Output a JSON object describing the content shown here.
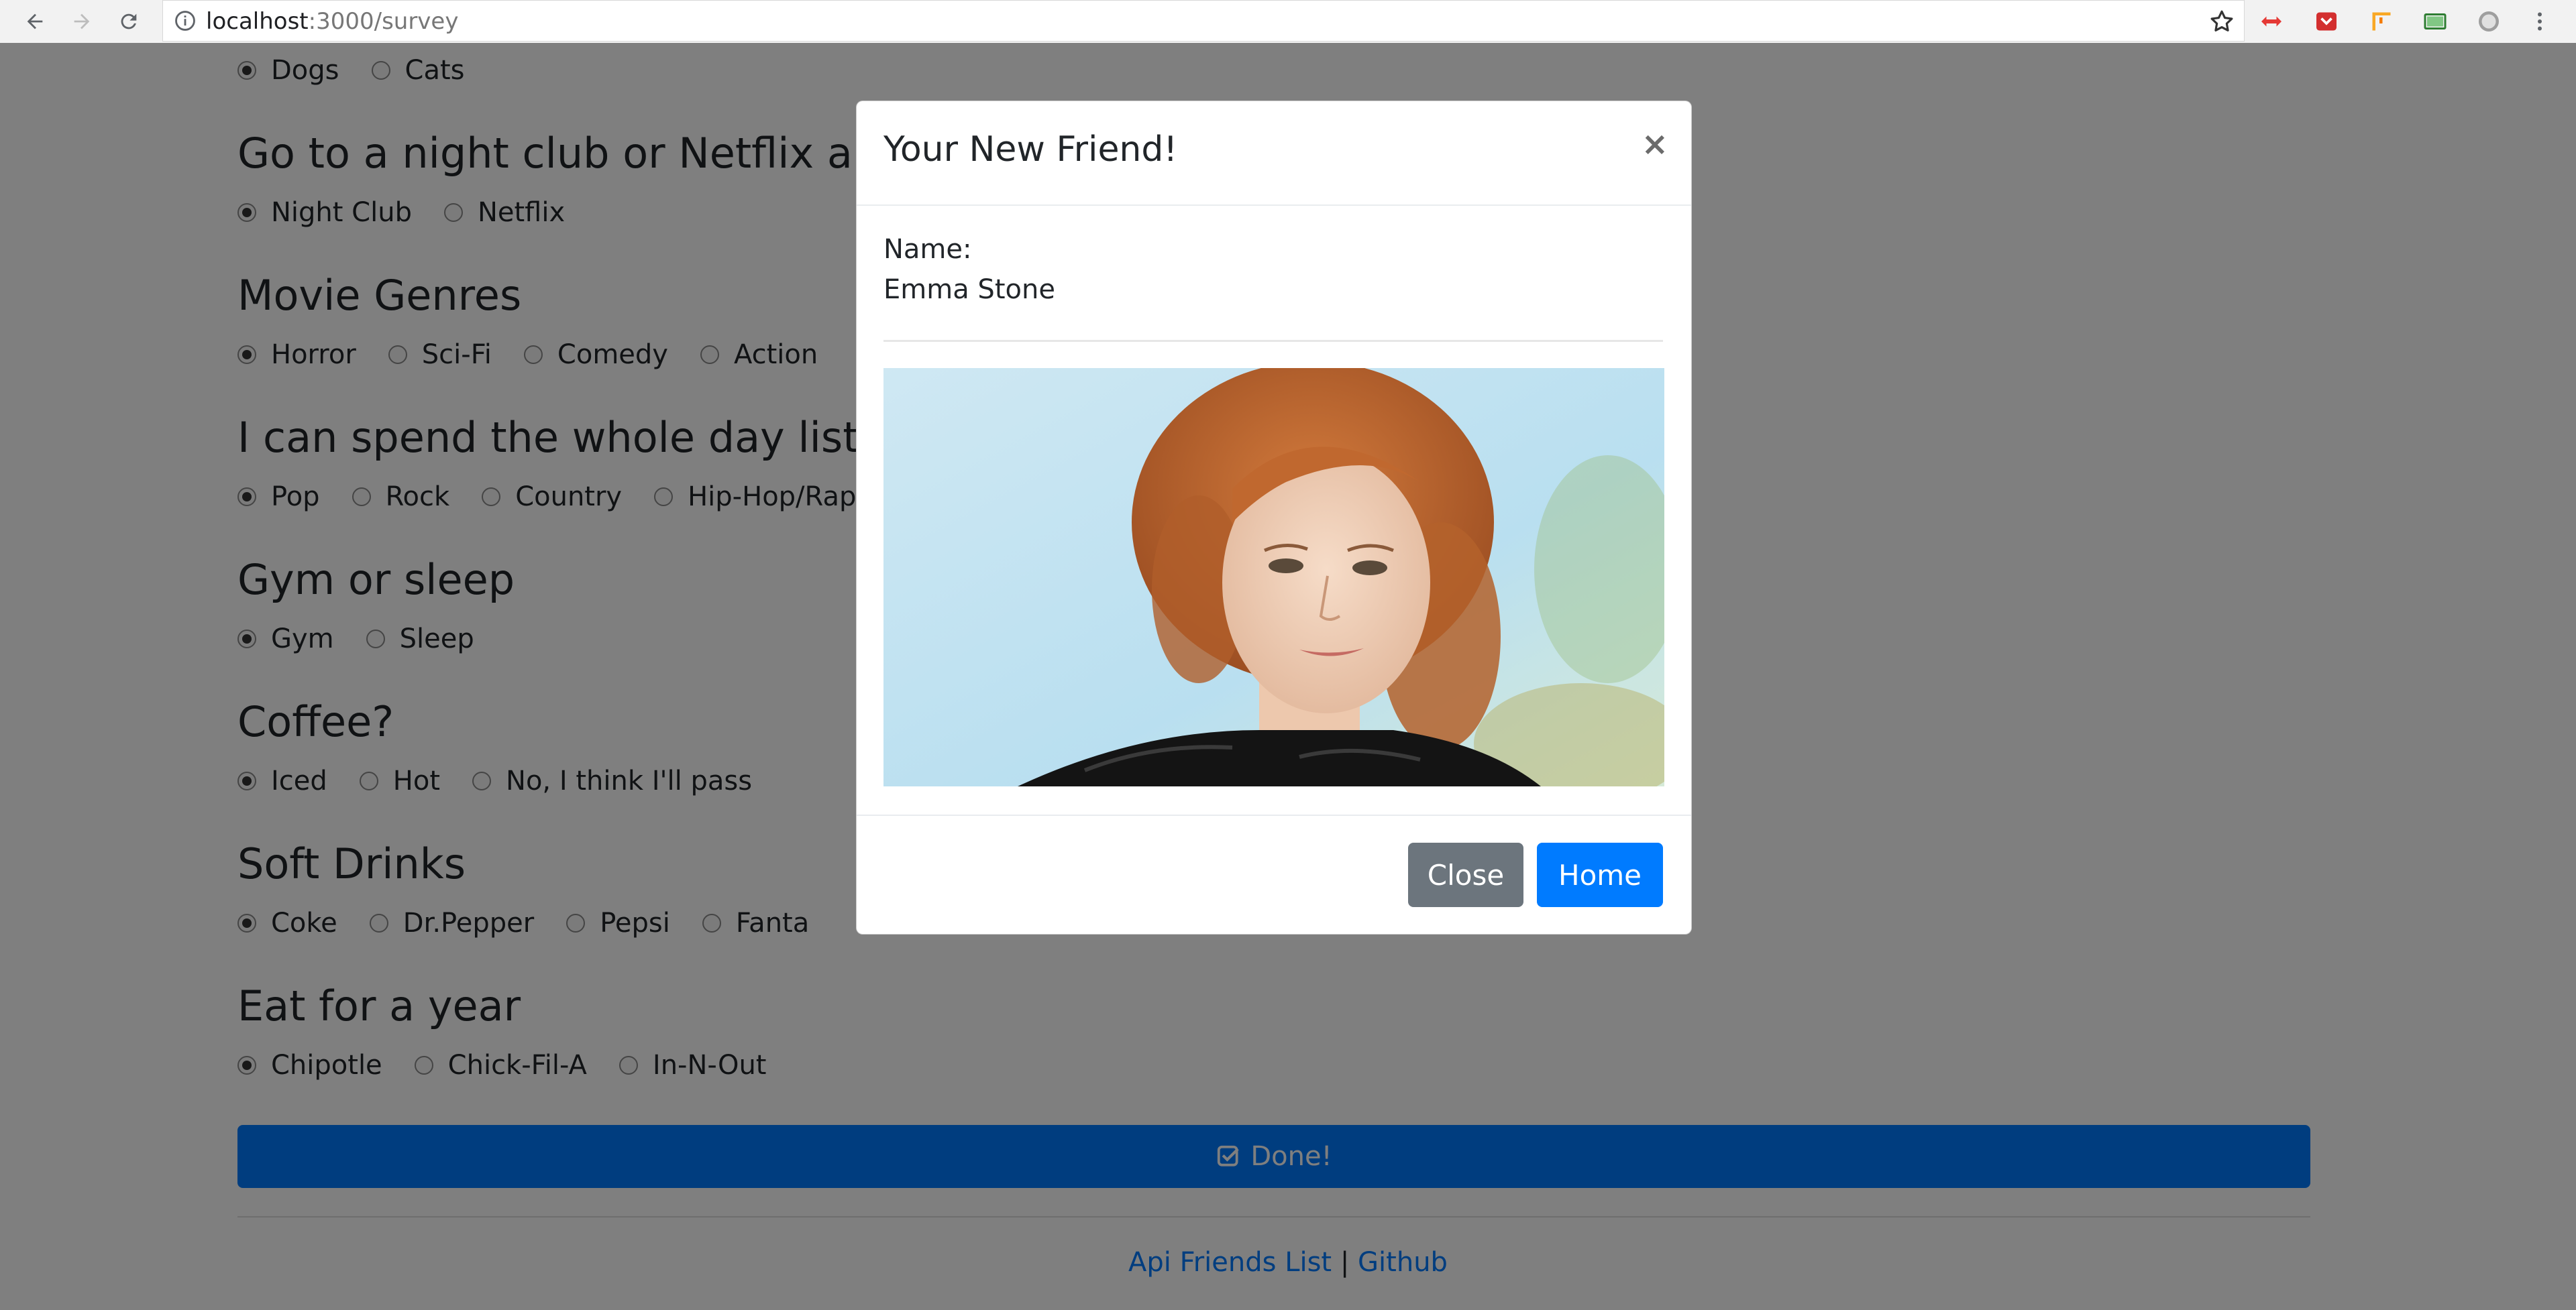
{
  "browser": {
    "url_host": "localhost",
    "url_path": ":3000/survey",
    "icons": [
      "back-icon",
      "forward-icon",
      "reload-icon",
      "info-icon",
      "star-icon",
      "extension-icons",
      "menu-icon"
    ]
  },
  "survey": {
    "top_options": [
      "Dogs",
      "Cats"
    ],
    "questions": [
      {
        "title": "Go to a night club or Netflix and chill?",
        "options": [
          "Night Club",
          "Netflix"
        ]
      },
      {
        "title": "Movie Genres",
        "options": [
          "Horror",
          "Sci-Fi",
          "Comedy",
          "Action"
        ]
      },
      {
        "title": "I can spend the whole day listening to...",
        "options": [
          "Pop",
          "Rock",
          "Country",
          "Hip-Hop/Rap"
        ]
      },
      {
        "title": "Gym or sleep",
        "options": [
          "Gym",
          "Sleep"
        ]
      },
      {
        "title": "Coffee?",
        "options": [
          "Iced",
          "Hot",
          "No, I think I'll pass"
        ]
      },
      {
        "title": "Soft Drinks",
        "options": [
          "Coke",
          "Dr.Pepper",
          "Pepsi",
          "Fanta"
        ]
      },
      {
        "title": "Eat for a year",
        "options": [
          "Chipotle",
          "Chick-Fil-A",
          "In-N-Out"
        ]
      }
    ],
    "done_label": "Done!"
  },
  "footer": {
    "link1": "Api Friends List",
    "separator": "|",
    "link2": "Github"
  },
  "modal": {
    "title": "Your New Friend!",
    "close_symbol": "×",
    "name_label": "Name:",
    "name_value": "Emma Stone",
    "close_button": "Close",
    "home_button": "Home"
  },
  "colors": {
    "primary": "#007bff",
    "secondary": "#6c757d",
    "backdrop": "rgba(0,0,0,0.5)"
  }
}
